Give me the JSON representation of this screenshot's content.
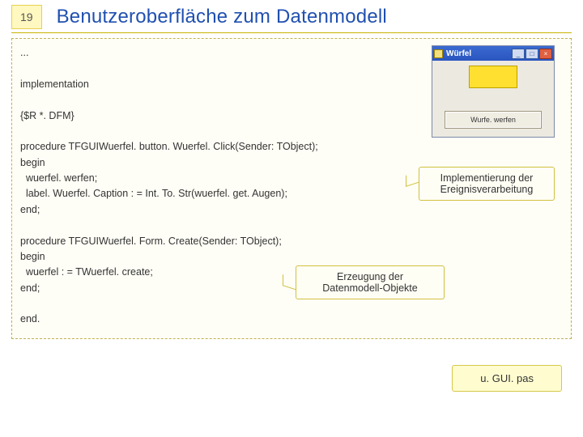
{
  "header": {
    "slide_number": "19",
    "title": "Benutzeroberfläche zum Datenmodell"
  },
  "code": {
    "ellipsis": "...",
    "section": "implementation",
    "directive": "{$R *. DFM}",
    "proc1_sig": "procedure TFGUIWuerfel. button. Wuerfel. Click(Sender: TObject);",
    "begin": "begin",
    "proc1_l1": "  wuerfel. werfen;",
    "proc1_l2": "  label. Wuerfel. Caption : = Int. To. Str(wuerfel. get. Augen);",
    "endsemi": "end;",
    "proc2_sig": "procedure TFGUIWuerfel. Form. Create(Sender: TObject);",
    "proc2_l1": "  wuerfel : = TWuerfel. create;",
    "enddot": "end."
  },
  "window": {
    "title": "Würfel",
    "button_label": "Wurfe. werfen"
  },
  "callouts": {
    "impl_line1": "Implementierung der",
    "impl_line2": "Ereignisverarbeitung",
    "create_line1": "Erzeugung der",
    "create_line2": "Datenmodell-Objekte"
  },
  "file_label": "u. GUI. pas"
}
